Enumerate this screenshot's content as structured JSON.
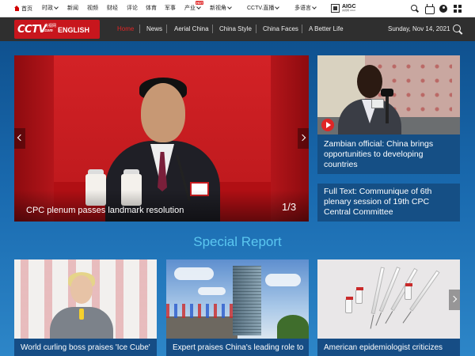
{
  "topbar": {
    "items": [
      {
        "label": "首页",
        "has_icon": true
      },
      {
        "label": "时政",
        "dropdown": true
      },
      {
        "label": "新闻"
      },
      {
        "label": "视频"
      },
      {
        "label": "财经"
      },
      {
        "label": "评论"
      },
      {
        "label": "体育"
      },
      {
        "label": "军事"
      },
      {
        "label": "产业",
        "dropdown": true,
        "badge": "HOT"
      },
      {
        "label": "新视角",
        "dropdown": true
      },
      {
        "label": "CCTV.直播",
        "dropdown": true
      },
      {
        "label": "多语言",
        "dropdown": true
      }
    ],
    "aigc_label": "AIGC",
    "aigc_sub": "央视网 AIGC",
    "icons": [
      "search-icon",
      "tv-icon",
      "user-icon",
      "apps-grid-icon"
    ]
  },
  "header": {
    "logo": {
      "cctv": "CCTV",
      "cn": "央视网",
      "com": ".com",
      "english": "ENGLISH"
    },
    "nav": [
      "Home",
      "News",
      "Aerial China",
      "China Style",
      "China Faces",
      "A Better Life"
    ],
    "active_nav": "Home",
    "date": "Sunday, Nov 14, 2021",
    "accent_color": "#e22525"
  },
  "hero": {
    "caption": "CPC plenum passes landmark resolution",
    "counter_current": "1",
    "counter_total": "/3"
  },
  "side_stories": [
    {
      "title": "Zambian official: China brings opportunities to developing countries",
      "has_video": true
    },
    {
      "title": "Full Text: Communique of 6th plenary session of 19th CPC Central Committee"
    }
  ],
  "special_report": {
    "title": "Special Report",
    "cards": [
      {
        "title": "World curling boss praises 'Ice Cube'"
      },
      {
        "title": "Expert praises China's leading role to"
      },
      {
        "title": "American epidemiologist criticizes"
      }
    ]
  }
}
